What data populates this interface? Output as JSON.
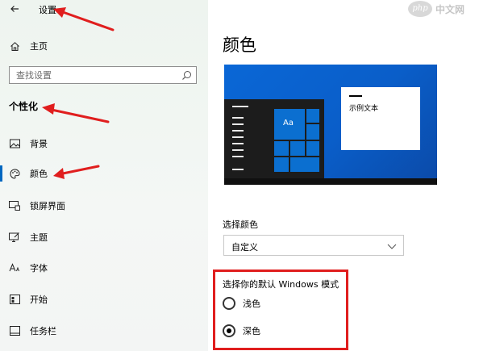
{
  "window": {
    "title": "设置",
    "back_icon": "back-arrow-icon"
  },
  "sidebar": {
    "home_label": "主页",
    "search_placeholder": "查找设置",
    "section_heading": "个性化",
    "items": [
      {
        "label": "背景",
        "icon": "picture-icon"
      },
      {
        "label": "颜色",
        "icon": "palette-icon",
        "active": true
      },
      {
        "label": "锁屏界面",
        "icon": "lock-screen-icon"
      },
      {
        "label": "主题",
        "icon": "theme-icon"
      },
      {
        "label": "字体",
        "icon": "font-icon"
      },
      {
        "label": "开始",
        "icon": "start-icon"
      },
      {
        "label": "任务栏",
        "icon": "taskbar-icon"
      }
    ],
    "accent_color": "#0067c0"
  },
  "main": {
    "title": "颜色",
    "preview": {
      "sample_text": "示例文本",
      "tile_text": "Aa"
    },
    "choose_color_label": "选择颜色",
    "choose_color_value": "自定义",
    "mode_label": "选择你的默认 Windows 模式",
    "modes": [
      {
        "label": "浅色",
        "checked": false
      },
      {
        "label": "深色",
        "checked": true
      }
    ]
  },
  "annotations": {
    "arrow_color": "#e01e1e"
  },
  "watermark": {
    "logo": "php",
    "text": "中文网"
  }
}
